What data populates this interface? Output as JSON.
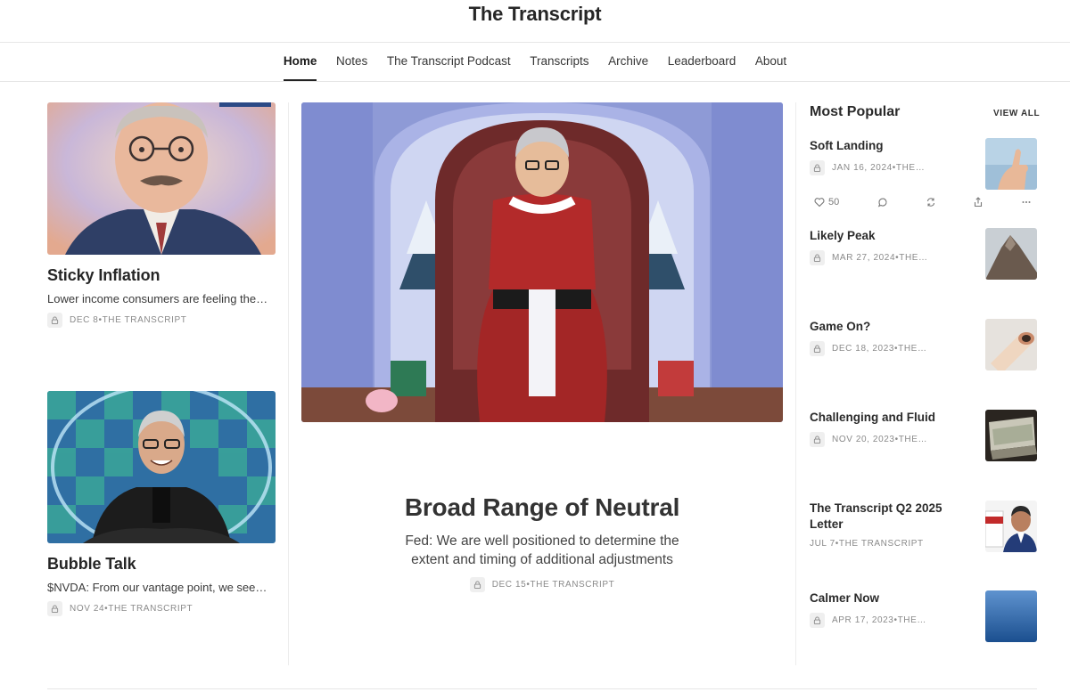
{
  "site": {
    "title": "The Transcript"
  },
  "nav": [
    {
      "label": "Home",
      "active": true
    },
    {
      "label": "Notes"
    },
    {
      "label": "The Transcript Podcast"
    },
    {
      "label": "Transcripts"
    },
    {
      "label": "Archive"
    },
    {
      "label": "Leaderboard"
    },
    {
      "label": "About"
    }
  ],
  "left_posts": [
    {
      "title": "Sticky Inflation",
      "subtitle": "Lower income consumers are feeling the…",
      "date": "DEC 8",
      "author": "THE TRANSCRIPT",
      "image": "man-with-mustache-illustration"
    },
    {
      "title": "Bubble Talk",
      "subtitle": "$NVDA: From our vantage point, we see…",
      "date": "NOV 24",
      "author": "THE TRANSCRIPT",
      "image": "man-in-bubble-illustration"
    }
  ],
  "hero": {
    "title": "Broad Range of Neutral",
    "subtitle": "Fed: We are well positioned to determine the extent and timing of additional adjustments",
    "date": "DEC 15",
    "author": "THE TRANSCRIPT",
    "image": "santa-on-throne-illustration"
  },
  "popular": {
    "heading": "Most Popular",
    "view_all": "VIEW ALL",
    "items": [
      {
        "title": "Soft Landing",
        "date": "JAN 16, 2024",
        "author": "THE…",
        "image": "thumbs-up-photo"
      },
      {
        "title": "Likely Peak",
        "date": "MAR 27, 2024",
        "author": "THE…",
        "image": "mountain-peak-photo"
      },
      {
        "title": "Game On?",
        "date": "DEC 18, 2023",
        "author": "THE…",
        "image": "rolled-bill-photo"
      },
      {
        "title": "Challenging and Fluid",
        "date": "NOV 20, 2023",
        "author": "THE…",
        "image": "cash-stack-photo"
      },
      {
        "title": "The Transcript Q2 2025 Letter",
        "date": "JUL 7",
        "author": "THE TRANSCRIPT",
        "image": "letter-cover-photo"
      },
      {
        "title": "Calmer Now",
        "date": "APR 17, 2023",
        "author": "THE…",
        "image": "calm-water-photo"
      }
    ],
    "actions": {
      "likes": "50"
    }
  },
  "meta_sep": " • ",
  "colors": {
    "accent": "#1a1a1a",
    "divider": "#e6e6e6",
    "meta": "#8a8a8a"
  }
}
